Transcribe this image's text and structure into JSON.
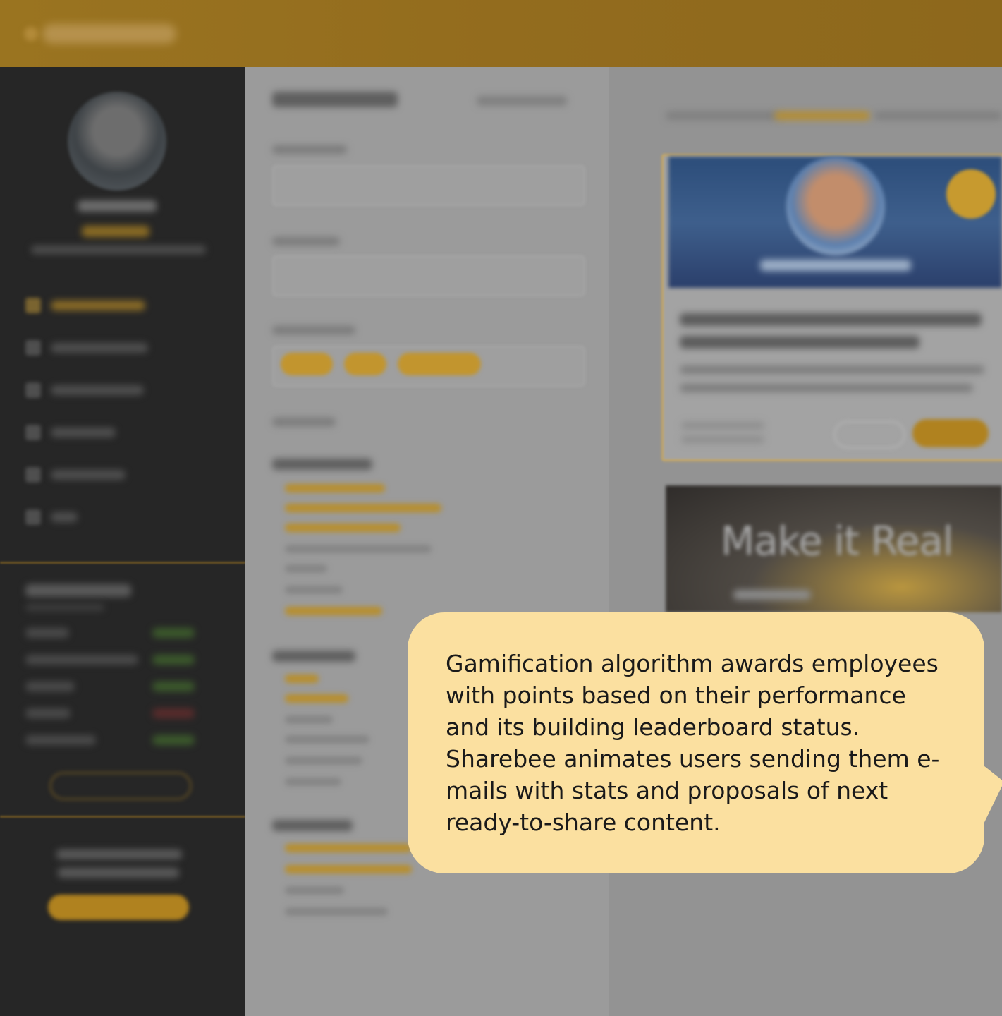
{
  "brand": {
    "accent": "#b0821f",
    "sidebar_bg": "#262626",
    "tooltip_bg": "#fbe0a0"
  },
  "feed": {
    "video_card": {
      "overlay_text": "Make it Real"
    }
  },
  "tooltip": {
    "text": "Gamification algorithm awards employees with points based on their performance and its building leaderboard status. Sharebee animates users sending them e-mails with stats and proposals of next ready-to-share content."
  }
}
